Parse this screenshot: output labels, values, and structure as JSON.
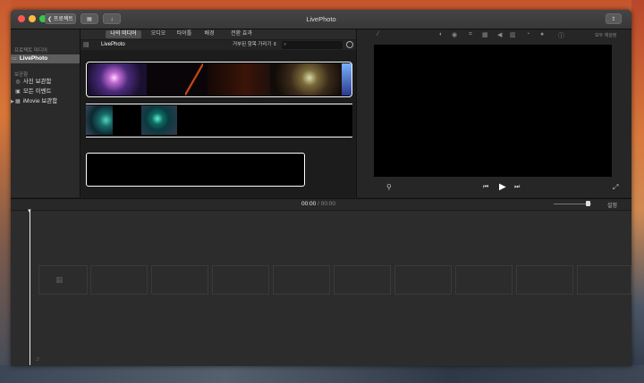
{
  "window": {
    "title": "LivePhoto",
    "back_button_label": "프로젝트"
  },
  "sidebar": {
    "section_project_media": "프로젝트 미디어",
    "project_item": "LivePhoto",
    "section_libraries": "보관함",
    "items": [
      {
        "label": "사진 보관함"
      },
      {
        "label": "모든 이벤트"
      },
      {
        "label": "iMovie 보관함"
      }
    ]
  },
  "browser": {
    "tabs": [
      {
        "label": "나의 미디어",
        "selected": true
      },
      {
        "label": "오디오"
      },
      {
        "label": "타이틀"
      },
      {
        "label": "배경"
      },
      {
        "label": "전환 효과"
      }
    ],
    "library_title": "LivePhoto",
    "filter_label": "거부된 항목 가리기"
  },
  "viewer": {
    "reset_all_label": "모두 재설정"
  },
  "timeline": {
    "current_time": "00:00",
    "separator": "/",
    "total_time": "00:00",
    "settings_label": "설정"
  },
  "colors": {
    "accent": "#ffffff",
    "sidebar_selected": "#5d5d5d",
    "close": "#fc5753",
    "minimize": "#fdbc40",
    "zoom": "#34c84a"
  }
}
